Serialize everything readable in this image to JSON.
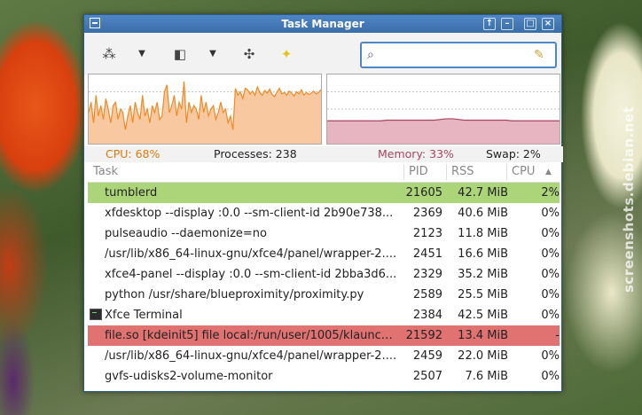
{
  "watermark": "screenshots.debian.net",
  "window": {
    "title": "Task Manager"
  },
  "search": {
    "value": ""
  },
  "stats": {
    "cpu": "CPU: 68%",
    "processes": "Processes: 238",
    "memory": "Memory: 33%",
    "swap": "Swap: 2%"
  },
  "graphs": {
    "cpu_values": [
      45,
      60,
      30,
      70,
      40,
      55,
      35,
      65,
      50,
      30,
      55,
      60,
      35,
      50,
      45,
      20,
      40,
      55,
      30,
      60,
      45,
      35,
      70,
      40,
      50,
      30,
      55,
      45,
      60,
      35,
      40,
      75,
      85,
      45,
      55,
      70,
      40,
      60,
      50,
      90,
      30,
      60,
      45,
      55,
      50,
      35,
      70,
      45,
      60,
      40,
      50,
      55,
      35,
      45,
      60,
      45,
      50,
      30,
      40,
      20,
      80,
      70,
      75,
      65,
      80,
      78,
      72,
      76,
      70,
      82,
      74,
      70,
      77,
      73,
      79,
      71,
      68,
      75,
      80,
      72,
      74,
      70,
      76,
      73,
      69,
      75,
      72,
      78,
      70,
      74,
      71,
      73,
      76,
      72,
      74,
      78
    ],
    "memory_values": [
      33,
      33,
      33,
      33,
      33,
      33,
      33,
      33,
      33,
      33,
      34,
      34,
      34,
      34,
      34,
      34,
      34,
      34,
      34,
      35,
      36,
      36,
      35,
      34,
      34,
      34,
      34,
      34,
      34,
      34,
      34,
      33,
      33,
      33,
      33,
      33,
      33,
      33,
      33,
      33
    ],
    "cpu_color": "#f08a24",
    "cpu_fill": "#f8c8a0",
    "memory_color": "#a8445e",
    "memory_fill": "#e7b5c2"
  },
  "table": {
    "headers": {
      "task": "Task",
      "pid": "PID",
      "rss": "RSS",
      "cpu": "CPU"
    },
    "rows": [
      {
        "name": "tumblerd",
        "pid": "21605",
        "rss": "42.7 MiB",
        "cpu": "2%",
        "highlight": "#acd479"
      },
      {
        "name": "xfdesktop --display :0.0 --sm-client-id 2b90e738...",
        "pid": "2369",
        "rss": "40.6 MiB",
        "cpu": "0%",
        "highlight": ""
      },
      {
        "name": "pulseaudio --daemonize=no",
        "pid": "2123",
        "rss": "11.8 MiB",
        "cpu": "0%",
        "highlight": ""
      },
      {
        "name": "/usr/lib/x86_64-linux-gnu/xfce4/panel/wrapper-2....",
        "pid": "2451",
        "rss": "16.6 MiB",
        "cpu": "0%",
        "highlight": ""
      },
      {
        "name": "xfce4-panel --display :0.0 --sm-client-id 2bba3d6...",
        "pid": "2329",
        "rss": "35.2 MiB",
        "cpu": "0%",
        "highlight": ""
      },
      {
        "name": "python /usr/share/blueproximity/proximity.py",
        "pid": "2589",
        "rss": "25.5 MiB",
        "cpu": "0%",
        "highlight": ""
      },
      {
        "name": "Xfce Terminal",
        "pid": "2384",
        "rss": "42.5 MiB",
        "cpu": "0%",
        "highlight": "",
        "icon": "terminal-icon"
      },
      {
        "name": "file.so [kdeinit5] file local:/run/user/1005/klaunch...",
        "pid": "21592",
        "rss": "13.4 MiB",
        "cpu": "-",
        "highlight": "#e07272"
      },
      {
        "name": "/usr/lib/x86_64-linux-gnu/xfce4/panel/wrapper-2....",
        "pid": "2459",
        "rss": "22.0 MiB",
        "cpu": "0%",
        "highlight": ""
      },
      {
        "name": "gvfs-udisks2-volume-monitor",
        "pid": "2507",
        "rss": "7.6 MiB",
        "cpu": "0%",
        "highlight": ""
      }
    ]
  }
}
